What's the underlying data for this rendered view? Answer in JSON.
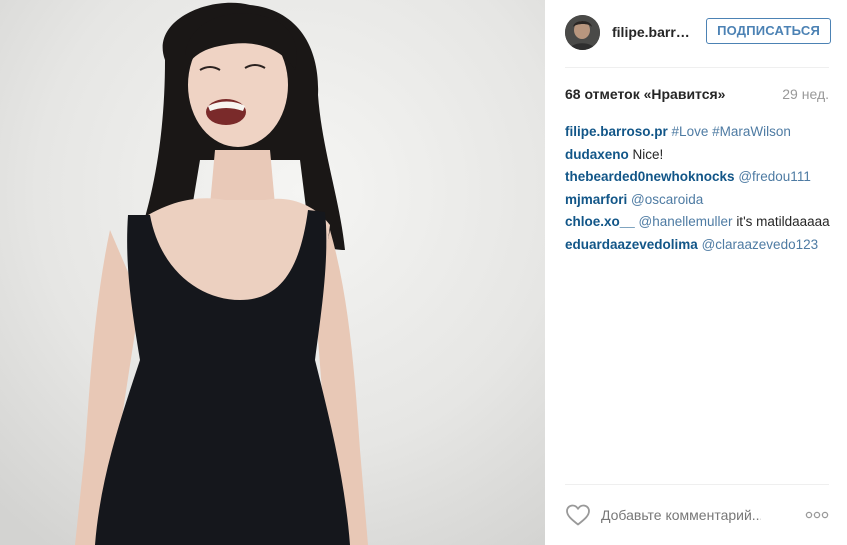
{
  "photo": {
    "alt": ""
  },
  "header": {
    "username": "filipe.barro…",
    "follow_label": "ПОДПИСАТЬСЯ"
  },
  "likes": {
    "text": "68 отметок «Нравится»",
    "time": "29 нед."
  },
  "comments": [
    {
      "author": "filipe.barroso.pr",
      "parts": [
        {
          "t": "link",
          "v": "#Love"
        },
        {
          "t": "link",
          "v": "#MaraWilson"
        }
      ]
    },
    {
      "author": "dudaxeno",
      "parts": [
        {
          "t": "text",
          "v": "Nice!"
        }
      ]
    },
    {
      "author": "thebearded0newhoknocks",
      "parts": [
        {
          "t": "link",
          "v": "@fredou111"
        }
      ]
    },
    {
      "author": "mjmarfori",
      "parts": [
        {
          "t": "link",
          "v": "@oscaroida"
        }
      ]
    },
    {
      "author": "chloe.xo__",
      "parts": [
        {
          "t": "link",
          "v": "@hanellemuller"
        },
        {
          "t": "text",
          "v": "it's matildaaaaa"
        }
      ]
    },
    {
      "author": "eduardaazevedolima",
      "parts": [
        {
          "t": "link",
          "v": "@claraazevedo123"
        }
      ]
    }
  ],
  "footer": {
    "comment_placeholder": "Добавьте комментарий...",
    "like_icon": "heart-outline-icon",
    "more_icon": "more-dots-icon"
  },
  "colors": {
    "author": "#125688",
    "link": "#4e7ba3",
    "follow_border": "#4c82b4",
    "muted": "#999999"
  }
}
